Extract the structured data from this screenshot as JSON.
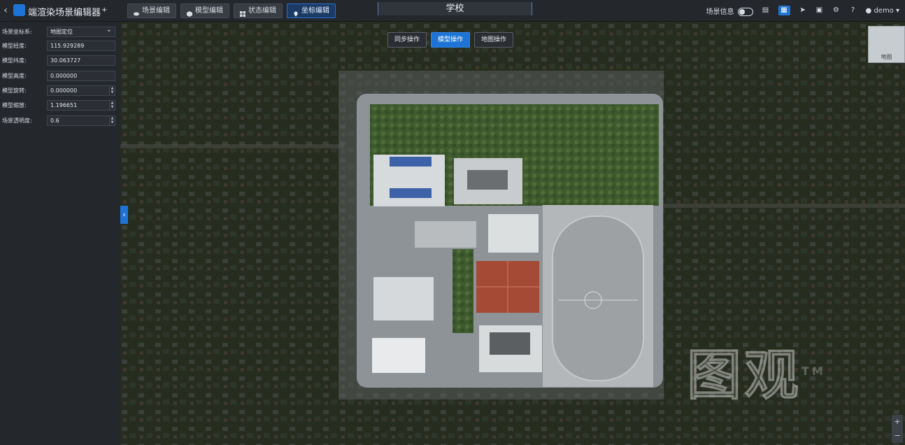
{
  "header": {
    "back_icon": "back-arrow-icon",
    "app_name": "端渲染场景编辑器",
    "tabs": [
      {
        "label": "场景编辑",
        "icon": "scene-icon"
      },
      {
        "label": "模型编辑",
        "icon": "model-icon"
      },
      {
        "label": "状态编辑",
        "icon": "state-icon"
      },
      {
        "label": "坐标编辑",
        "icon": "coordinate-icon",
        "active": true
      }
    ],
    "scene_title": "学校",
    "scene_info_label": "场景信息",
    "user": "demo",
    "accent_color": "#1e74d6"
  },
  "left_panel": {
    "coord_system": {
      "label": "场景坐标系:",
      "value": "地图定位"
    },
    "fields": [
      {
        "label": "模型经度:",
        "value": "115.929289"
      },
      {
        "label": "模型纬度:",
        "value": "30.063727"
      },
      {
        "label": "模型高度:",
        "value": "0.000000"
      },
      {
        "label": "模型旋转:",
        "value": "0.000000"
      },
      {
        "label": "模型缩放:",
        "value": "1.196651"
      },
      {
        "label": "场景透明度:",
        "value": "0.6"
      }
    ]
  },
  "map": {
    "modes": [
      {
        "label": "同步操作"
      },
      {
        "label": "模型操作",
        "active": true
      },
      {
        "label": "地图操作"
      }
    ],
    "minimap_label": "地图",
    "watermark": "图观",
    "watermark_tm": "TM",
    "zoom_in": "+",
    "zoom_out": "−"
  }
}
